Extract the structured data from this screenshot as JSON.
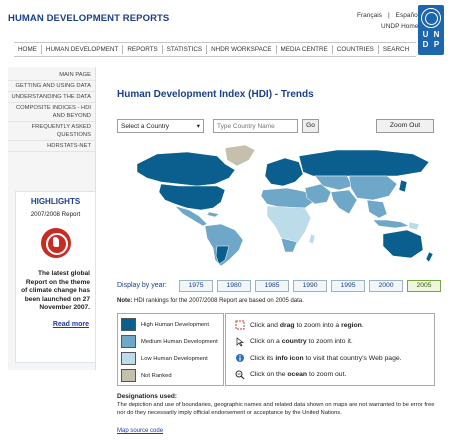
{
  "header": {
    "site_title": "HUMAN DEVELOPMENT REPORTS",
    "languages": [
      "Français",
      "Español"
    ],
    "undp_home": "UNDP Home",
    "logo_letters": [
      "U",
      "N",
      "D",
      "P"
    ]
  },
  "nav": [
    "HOME",
    "HUMAN DEVELOPMENT",
    "REPORTS",
    "STATISTICS",
    "NHDR WORKSPACE",
    "MEDIA CENTRE",
    "COUNTRIES",
    "SEARCH"
  ],
  "sidebar": {
    "items": [
      "MAIN PAGE",
      "GETTING AND USING DATA",
      "UNDERSTANDING THE DATA",
      "COMPOSITE INDICES - HDI AND BEYOND",
      "FREQUENTLY ASKED QUESTIONS",
      "HDRSTATS-NET"
    ],
    "highlights": {
      "title": "HIGHLIGHTS",
      "subtitle": "2007/2008 Report",
      "text": "The latest global Report on the theme of climate change has been launched on 27 November 2007.",
      "read_more": "Read more"
    }
  },
  "main": {
    "title": "Human Development Index (HDI) - Trends",
    "select_country": "Select a Country",
    "search_placeholder": "Type Country Name",
    "go": "Go",
    "zoom_out": "Zoom Out",
    "display_by_year": "Display by year:",
    "years": [
      "1975",
      "1980",
      "1985",
      "1990",
      "1995",
      "2000",
      "2005"
    ],
    "selected_year": "2005",
    "note_label": "Note:",
    "note_text": "HDI rankings for the 2007/2008 Report are based on 2005 data."
  },
  "legend": [
    {
      "label": "High Human Development",
      "color": "#0b5f8e"
    },
    {
      "label": "Medium Human Development",
      "color": "#6fa7c9"
    },
    {
      "label": "Low Human Development",
      "color": "#bcdcea"
    },
    {
      "label": "Not Ranked",
      "color": "#c4c0ad"
    }
  ],
  "instructions": [
    {
      "icon": "drag-select-icon",
      "pre": "Click and ",
      "bold": "drag",
      "mid": " to zoom into a ",
      "bold2": "region",
      "post": "."
    },
    {
      "icon": "cursor-icon",
      "pre": "Click on a ",
      "bold": "country",
      "mid": " to zoom into it.",
      "bold2": "",
      "post": ""
    },
    {
      "icon": "info-icon",
      "pre": "Click its ",
      "bold": "info icon",
      "mid": " to visit that country's Web page.",
      "bold2": "",
      "post": ""
    },
    {
      "icon": "zoom-out-icon",
      "pre": "Click on the ",
      "bold": "ocean",
      "mid": " to zoom out.",
      "bold2": "",
      "post": ""
    }
  ],
  "designations": {
    "title": "Designations used:",
    "text": "The depiction and use of boundaries, geographic names and related data shown on maps are not warranted to be error free nor do they necessarily imply official endorsement or acceptance by the United Nations.",
    "map_source": "Map source code"
  },
  "colors": {
    "brand_blue": "#1b3f8b",
    "undp_blue": "#1d65ad",
    "high": "#0b5f8e",
    "medium": "#6fa7c9",
    "low": "#bcdcea",
    "not_ranked": "#c4c0ad"
  }
}
